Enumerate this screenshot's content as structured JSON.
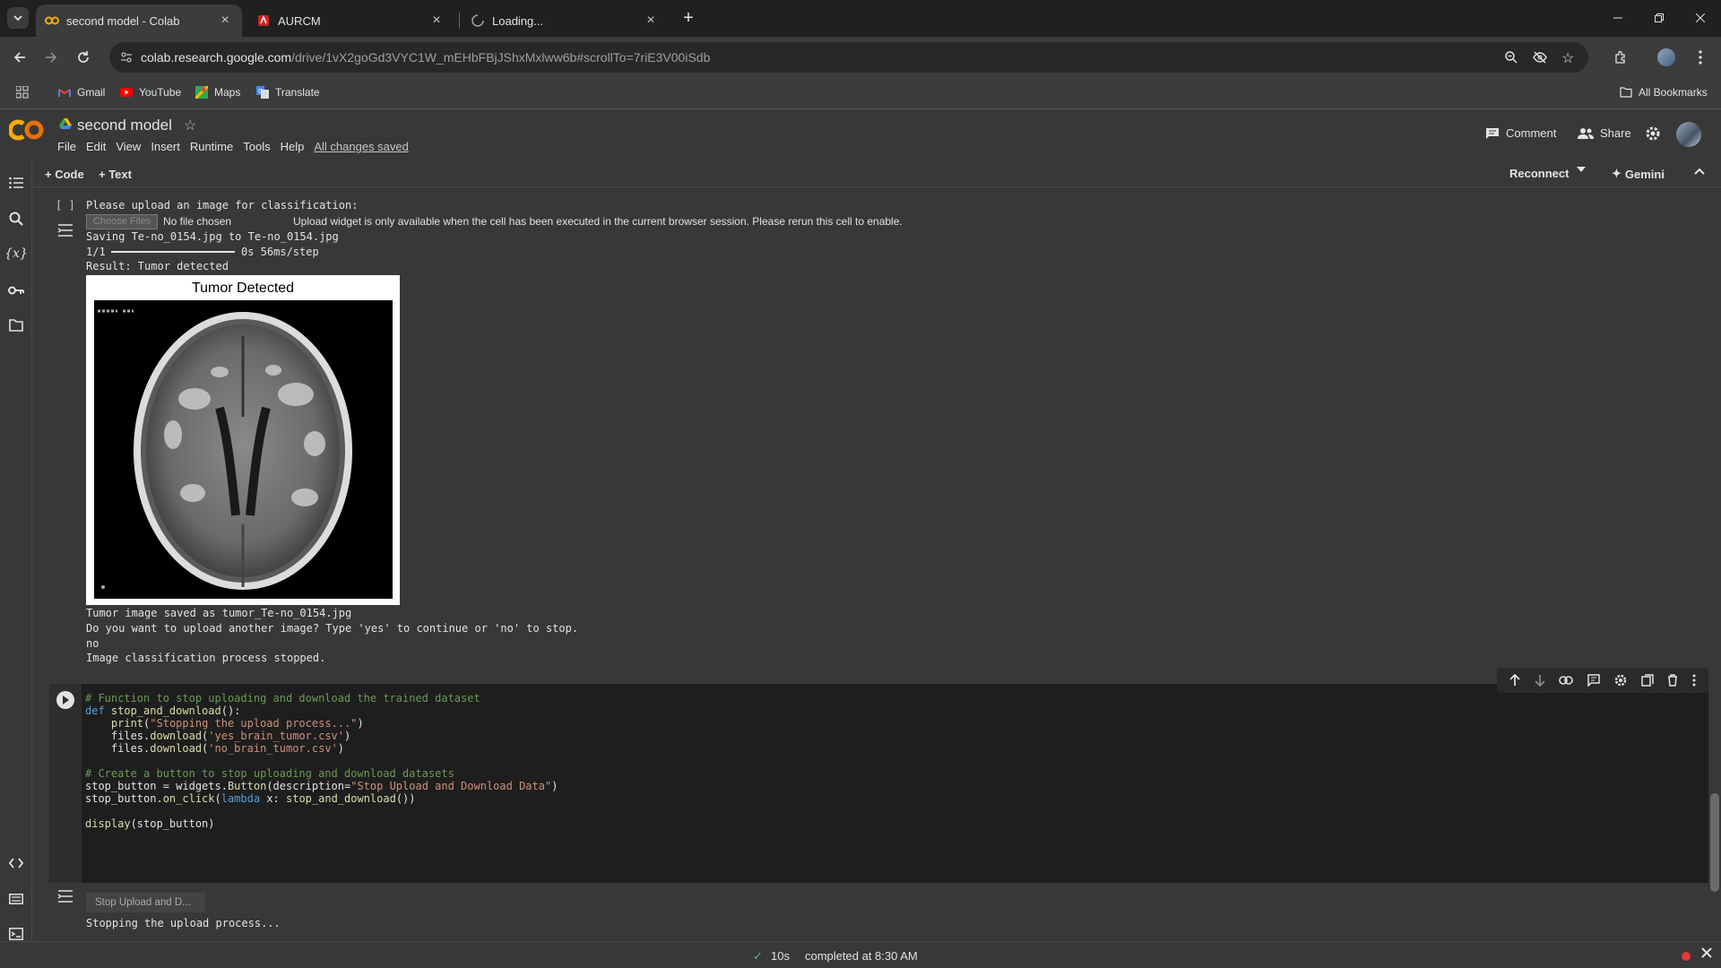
{
  "browser": {
    "tabs": [
      {
        "title": "second model - Colab",
        "active": true
      },
      {
        "title": "AURCM",
        "active": false
      },
      {
        "title": "Loading...",
        "active": false
      }
    ],
    "url_host": "colab.research.google.com",
    "url_path": "/drive/1vX2goGd3VYC1W_mEHbFBjJShxMxlww6b#scrollTo=7riE3V00iSdb",
    "bookmarks": [
      "Gmail",
      "YouTube",
      "Maps",
      "Translate"
    ],
    "all_bookmarks": "All Bookmarks"
  },
  "colab": {
    "notebook_title": "second model",
    "menu": [
      "File",
      "Edit",
      "View",
      "Insert",
      "Runtime",
      "Tools",
      "Help"
    ],
    "save_status": "All changes saved",
    "comment_label": "Comment",
    "share_label": "Share",
    "add_code": "+ Code",
    "add_text": "+ Text",
    "reconnect": "Reconnect",
    "gemini": "Gemini"
  },
  "cell1": {
    "exec_count": "[ ]",
    "prompt": "Please upload an image for classification:",
    "choose_files": "Choose Files",
    "no_file": "No file chosen",
    "widget_note": "Upload widget is only available when the cell has been executed in the current browser session. Please rerun this cell to enable.",
    "saving": "Saving Te-no_0154.jpg to Te-no_0154.jpg",
    "progress_prefix": "1/1",
    "progress_suffix": "0s 56ms/step",
    "progress": 1.0,
    "result": "Result: Tumor detected",
    "plot_title": "Tumor Detected",
    "saved_msg": "Tumor image saved as tumor_Te-no_0154.jpg",
    "question": "Do you want to upload another image? Type 'yes' to continue or 'no' to stop.",
    "answer": "no",
    "stopped": "Image classification process stopped."
  },
  "cell2": {
    "code_lines": [
      {
        "cls": "cm",
        "text": "# Function to stop uploading and download the trained dataset"
      },
      {
        "parts": [
          [
            "kw",
            "def "
          ],
          [
            "fn",
            "stop_and_download"
          ],
          [
            "",
            "():"
          ]
        ]
      },
      {
        "parts": [
          [
            "",
            "    "
          ],
          [
            "fn",
            "print"
          ],
          [
            "",
            "("
          ],
          [
            "st",
            "\"Stopping the upload process...\""
          ],
          [
            "",
            ")"
          ]
        ]
      },
      {
        "parts": [
          [
            "",
            "    files."
          ],
          [
            "fn",
            "download"
          ],
          [
            "",
            "("
          ],
          [
            "st",
            "'yes_brain_tumor.csv'"
          ],
          [
            "",
            ")"
          ]
        ]
      },
      {
        "parts": [
          [
            "",
            "    files."
          ],
          [
            "fn",
            "download"
          ],
          [
            "",
            "("
          ],
          [
            "st",
            "'no_brain_tumor.csv'"
          ],
          [
            "",
            ")"
          ]
        ]
      },
      {
        "parts": [
          [
            "",
            ""
          ]
        ]
      },
      {
        "cls": "cm",
        "text": "# Create a button to stop uploading and download datasets"
      },
      {
        "parts": [
          [
            "",
            "stop_button = widgets."
          ],
          [
            "fn",
            "Button"
          ],
          [
            "",
            "(description="
          ],
          [
            "st",
            "\"Stop Upload and Download Data\""
          ],
          [
            "",
            ")"
          ]
        ]
      },
      {
        "parts": [
          [
            "",
            "stop_button."
          ],
          [
            "fn",
            "on_click"
          ],
          [
            "",
            "("
          ],
          [
            "kw",
            "lambda"
          ],
          [
            "",
            " x: "
          ],
          [
            "fn",
            "stop_and_download"
          ],
          [
            "",
            "())"
          ]
        ]
      },
      {
        "parts": [
          [
            "",
            ""
          ]
        ]
      },
      {
        "parts": [
          [
            "fn",
            "display"
          ],
          [
            "",
            "(stop_button)"
          ]
        ]
      }
    ],
    "button_label": "Stop Upload and D...",
    "output": "Stopping the upload process..."
  },
  "status": {
    "duration": "10s",
    "completed": "completed at 8:30 AM"
  }
}
